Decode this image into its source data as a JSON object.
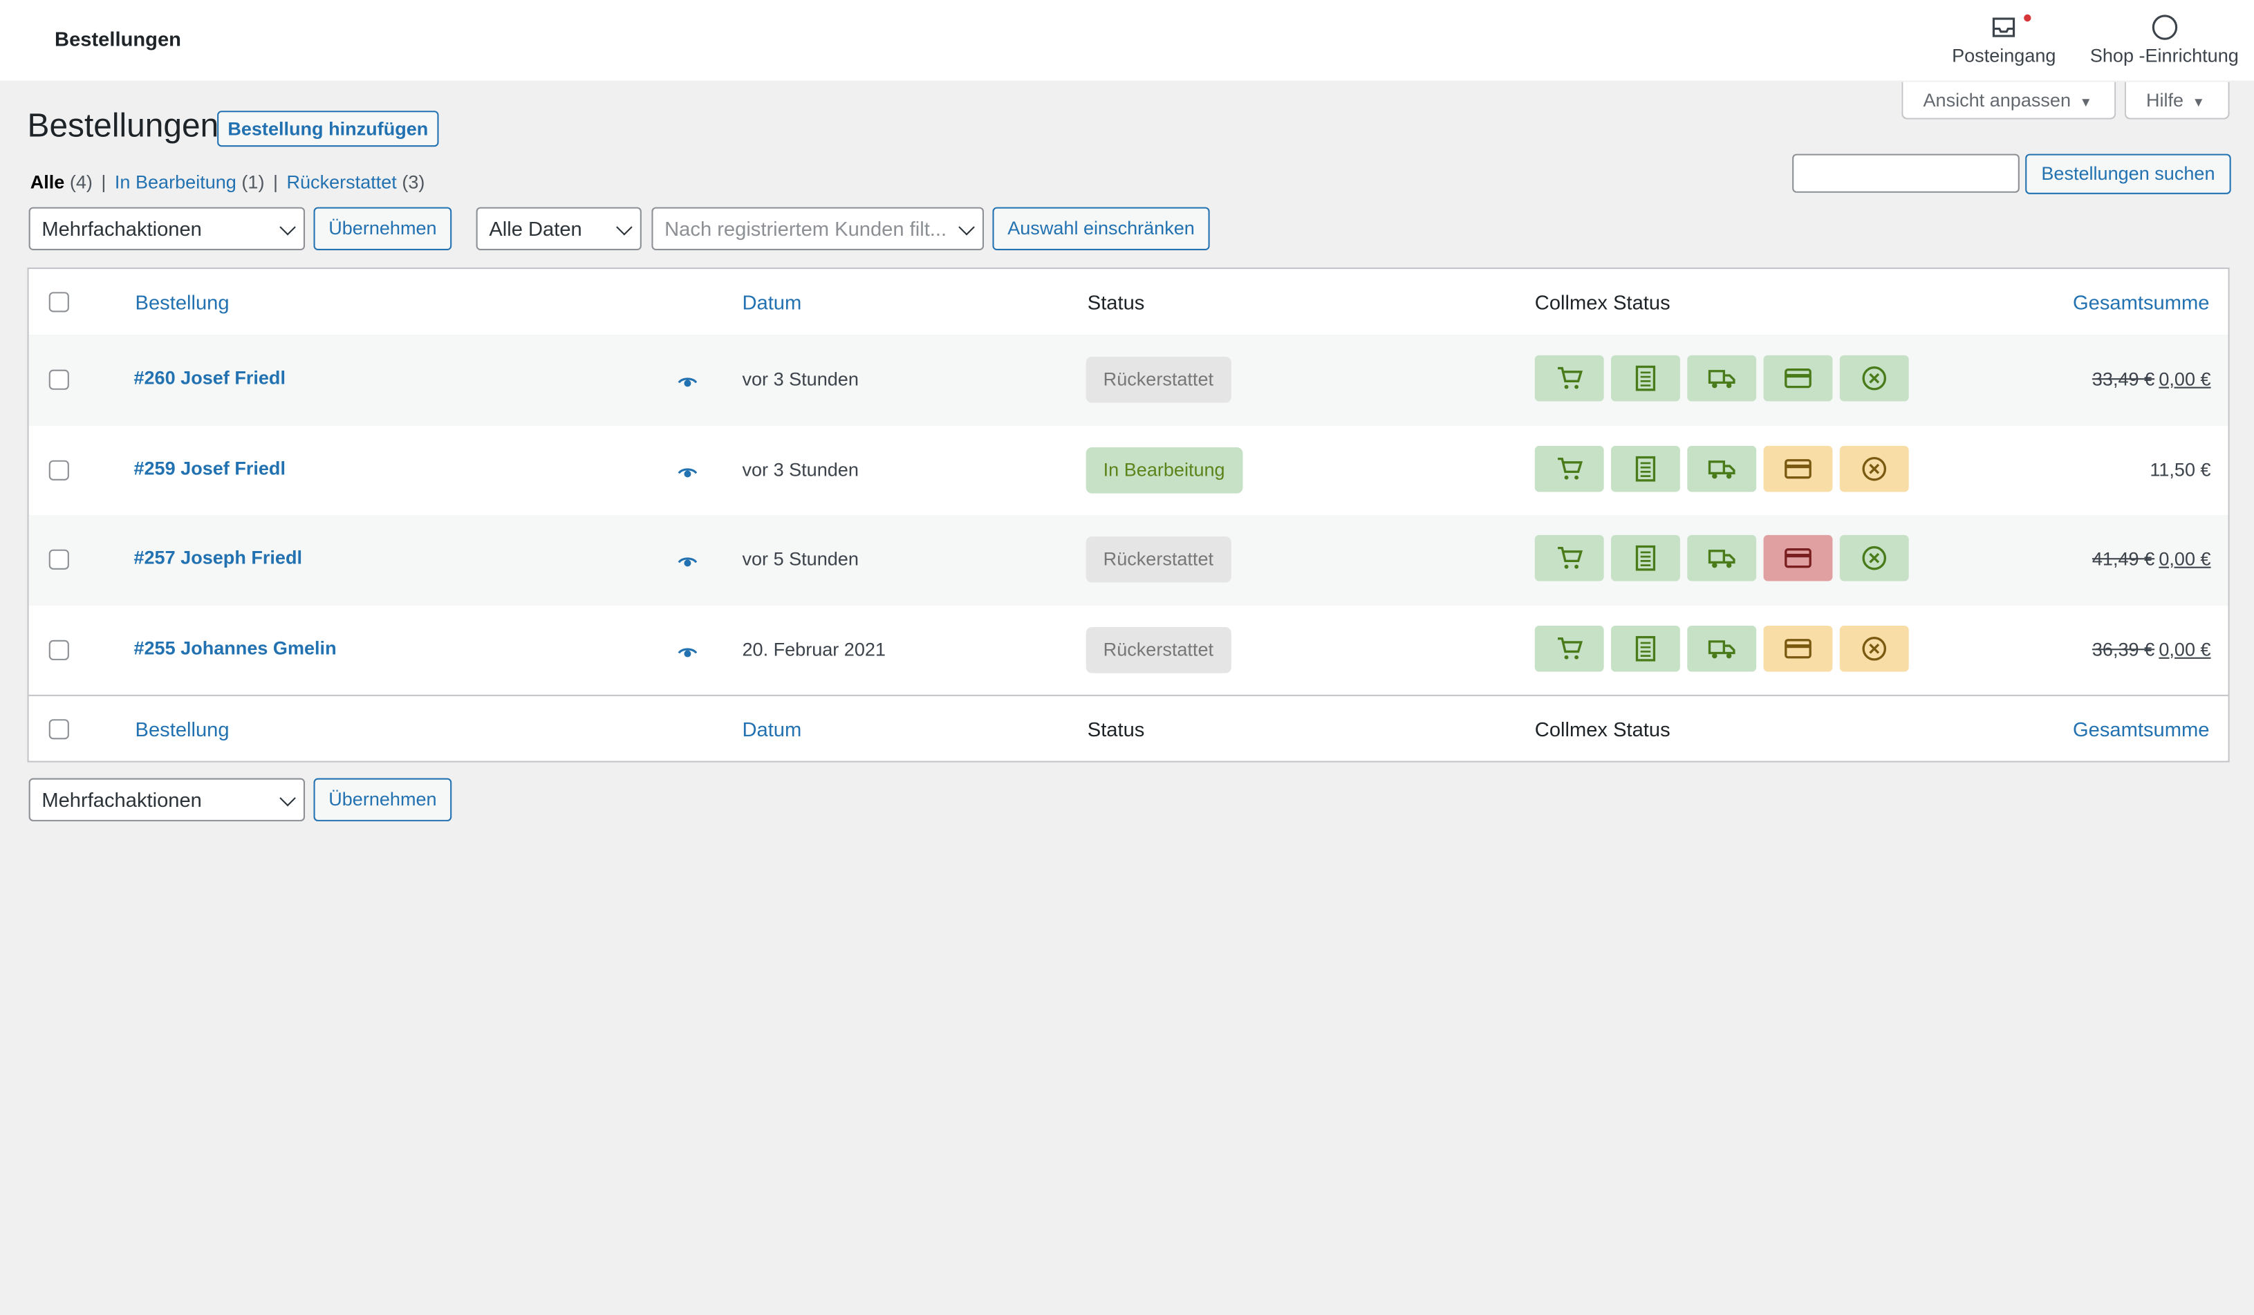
{
  "topbar": {
    "title": "Bestellungen",
    "inbox_label": "Posteingang",
    "setup_label": "Shop -Einrichtung"
  },
  "screen_options": {
    "view_label": "Ansicht anpassen",
    "help_label": "Hilfe"
  },
  "page": {
    "heading": "Bestellungen",
    "add_button": "Bestellung hinzufügen"
  },
  "filters_links": [
    {
      "label": "Alle",
      "count": "(4)"
    },
    {
      "label": "In Bearbeitung",
      "count": "(1)"
    },
    {
      "label": "Rückerstattet",
      "count": "(3)"
    }
  ],
  "search": {
    "value": "",
    "button": "Bestellungen suchen"
  },
  "bulk": {
    "selected": "Mehrfachaktionen",
    "apply": "Übernehmen"
  },
  "date_filter": {
    "selected": "Alle Daten"
  },
  "customer_filter": {
    "placeholder": "Nach registriertem Kunden filt..."
  },
  "filter_button": "Auswahl einschränken",
  "columns": {
    "order": "Bestellung",
    "date": "Datum",
    "status": "Status",
    "collmex": "Collmex Status",
    "total": "Gesamtsumme"
  },
  "orders": [
    {
      "order": "#260 Josef Friedl",
      "date": "vor 3 Stunden",
      "status": "Rückerstattet",
      "status_kind": "refunded",
      "collmex": [
        "green",
        "green",
        "green",
        "green",
        "green"
      ],
      "total_old": "33,49 €",
      "total": "0,00 €"
    },
    {
      "order": "#259 Josef Friedl",
      "date": "vor 3 Stunden",
      "status": "In Bearbeitung",
      "status_kind": "processing",
      "collmex": [
        "green",
        "green",
        "green",
        "yellow",
        "yellow"
      ],
      "total_old": "",
      "total": "11,50 €"
    },
    {
      "order": "#257 Joseph Friedl",
      "date": "vor 5 Stunden",
      "status": "Rückerstattet",
      "status_kind": "refunded",
      "collmex": [
        "green",
        "green",
        "green",
        "red",
        "green"
      ],
      "total_old": "41,49 €",
      "total": "0,00 €"
    },
    {
      "order": "#255 Johannes Gmelin",
      "date": "20. Februar 2021",
      "status": "Rückerstattet",
      "status_kind": "refunded",
      "collmex": [
        "green",
        "green",
        "green",
        "yellow",
        "yellow"
      ],
      "total_old": "36,39 €",
      "total": "0,00 €"
    }
  ],
  "collmex_icons": [
    "cart-icon",
    "invoice-icon",
    "truck-icon",
    "credit-card-icon",
    "cancel-circle-icon"
  ],
  "colors": {
    "link": "#2271b1",
    "green_icon": "#4a7b1a",
    "red_icon": "#7a1f1f",
    "yellow_icon": "#7a5a10"
  }
}
